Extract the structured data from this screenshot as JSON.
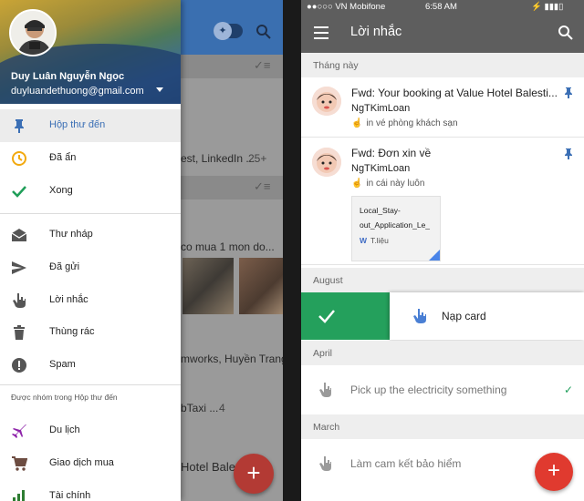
{
  "left_phone": {
    "background_app": {
      "rows": [
        {
          "text": "est, LinkedIn ...",
          "count": "25+"
        },
        {
          "text": "co mua 1 mon do..."
        },
        {
          "text": "mworks, Huyền Trang"
        },
        {
          "text": "bTaxi ...",
          "count": "4"
        },
        {
          "text": "Hotel Bales"
        }
      ],
      "fab_label": "+"
    },
    "drawer": {
      "account": {
        "name": "Duy Luân Nguyễn Ngọc",
        "email": "duyluandethuong@gmail.com"
      },
      "items": [
        {
          "label": "Hộp thư đến",
          "icon": "pin-icon",
          "active": true
        },
        {
          "label": "Đã ẩn",
          "icon": "clock-icon"
        },
        {
          "label": "Xong",
          "icon": "check-icon"
        },
        {
          "label": "Thư nháp",
          "icon": "drafts-icon"
        },
        {
          "label": "Đã gửi",
          "icon": "send-icon"
        },
        {
          "label": "Lời nhắc",
          "icon": "reminder-hand-icon"
        },
        {
          "label": "Thùng rác",
          "icon": "trash-icon"
        },
        {
          "label": "Spam",
          "icon": "spam-icon"
        }
      ],
      "group_title": "Được nhóm trong Hộp thư đến",
      "groups": [
        {
          "label": "Du lịch",
          "icon": "plane-icon"
        },
        {
          "label": "Giao dịch mua",
          "icon": "cart-icon"
        },
        {
          "label": "Tài chính",
          "icon": "finance-icon"
        }
      ]
    },
    "colors": {
      "inbox_blue": "#3b6fb5",
      "fab": "#b33a34"
    }
  },
  "right_phone": {
    "status_bar": {
      "carrier": "●●○○○ VN Mobifone",
      "time": "6:58 AM"
    },
    "title": "Lời nhắc",
    "sections": {
      "this_month": "Tháng này",
      "august": "August",
      "april": "April",
      "march": "March"
    },
    "emails": [
      {
        "subject": "Fwd: Your booking at Value Hotel Balesti...",
        "sender": "NgTKimLoan",
        "reminder": "in vé phòng khách sạn"
      },
      {
        "subject": "Fwd: Đơn xin về",
        "sender": "NgTKimLoan",
        "reminder": "in cái này luôn",
        "attachment": {
          "name_line1": "Local_Stay-",
          "name_line2": "out_Application_Le_",
          "type_letter": "W",
          "type_label": "T.liệu"
        }
      }
    ],
    "swiped_reminder": {
      "label": "Nạp card"
    },
    "reminders": [
      {
        "label": "Pick up the electricity something",
        "done": true
      },
      {
        "label": "Làm cam kết bảo hiểm",
        "done": false
      }
    ],
    "fab_label": "+",
    "colors": {
      "appbar": "#5e5e5e",
      "swipe_done": "#24a05c",
      "fab": "#e03a2f",
      "reminder_blue": "#4a7fd4"
    }
  }
}
